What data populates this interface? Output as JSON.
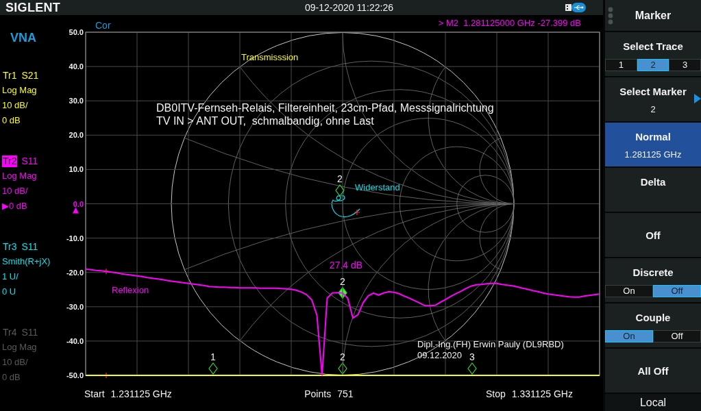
{
  "top_bar": {
    "brand": "SIGLENT",
    "datetime": "09-12-2020 11:22:26"
  },
  "mode": "VNA",
  "traces": [
    {
      "name": "Tr1",
      "param": "S21",
      "format": "Log Mag",
      "scale": "10 dB/",
      "reference": "0 dB",
      "color": "#ffff00",
      "selected": false,
      "on": true
    },
    {
      "name": "Tr2",
      "param": "S11",
      "format": "Log Mag",
      "scale": "10 dB/",
      "reference": "▶0 dB",
      "color": "#ff00ff",
      "selected": true,
      "on": true
    },
    {
      "name": "Tr3",
      "param": "S11",
      "format": "Smith(R+jX)",
      "scale": "1 U/",
      "reference": "0 U",
      "color": "#00e5f0",
      "selected": false,
      "on": true
    },
    {
      "name": "Tr4",
      "param": "S11",
      "format": "Log Mag",
      "scale": "10 dB/",
      "reference": "0 dB",
      "selected": false,
      "on": false
    }
  ],
  "plot": {
    "status": "Cor",
    "marker_readout": "> M2  1.281125000 GHz -27.399 dB",
    "notes": [
      {
        "lines": [
          "DB0ITV-Fernseh-Relais, Filtereinheit, 23cm-Pfad, Messsignalrichtung",
          "TV IN > ANT OUT,  schmalbandig, ohne Last"
        ]
      },
      {
        "lines": [
          "Dipl.-Ing.(FH) Erwin Pauly (DL9RBD)",
          "09.12.2020"
        ]
      }
    ],
    "smith": {
      "label": "Widerstand",
      "color": "#00e5f0",
      "marker": {
        "text": "2",
        "selected": false
      }
    },
    "markers": [
      {
        "text": "2",
        "selected": true
      },
      {
        "text": "1",
        "selected": false
      },
      {
        "text": "2",
        "selected": false
      },
      {
        "text": "3",
        "selected": false
      }
    ],
    "marker_value": "27.4 dB",
    "chart_data": {
      "type": "line",
      "grid": true,
      "ylim": [
        -50,
        50
      ],
      "yticks": [
        {
          "value": 50,
          "label": "50.0"
        },
        {
          "value": 40,
          "label": "40.0"
        },
        {
          "value": 30,
          "label": "30.0"
        },
        {
          "value": 20,
          "label": "20.0"
        },
        {
          "value": 10,
          "label": "10.0"
        },
        {
          "value": 0,
          "label": "0.0"
        },
        {
          "value": -10,
          "label": "-10.0"
        },
        {
          "value": -20,
          "label": "-20.0"
        },
        {
          "value": -30,
          "label": "-30.0"
        },
        {
          "value": -40,
          "label": "-40.0"
        },
        {
          "value": -50,
          "label": "-50.0"
        }
      ],
      "categories": [
        null,
        null,
        null,
        null,
        null,
        null,
        null,
        null,
        null,
        null,
        null,
        null,
        null,
        null,
        null,
        null,
        null,
        null,
        null,
        null,
        null,
        null,
        null,
        null,
        null,
        null,
        null,
        null,
        null,
        null,
        null,
        null,
        null,
        null,
        null,
        null,
        null,
        null,
        null,
        null,
        null,
        null,
        null,
        null,
        null,
        null,
        null,
        null,
        null,
        null,
        null,
        null,
        null,
        null,
        null,
        null,
        null,
        null,
        null,
        null,
        null,
        null,
        null,
        null,
        null,
        null,
        null,
        null,
        null,
        null,
        null,
        null,
        null,
        null,
        null,
        null,
        null,
        null,
        null,
        null,
        null,
        null,
        null,
        null,
        null,
        null,
        null,
        null,
        null,
        null,
        null,
        null,
        null,
        null,
        null,
        null,
        null,
        null,
        null,
        null,
        null
      ],
      "series": [
        {
          "name": "Transmisssion",
          "color": "#ffff00",
          "values": [
            -50,
            -50,
            -50,
            -50,
            -50,
            -50,
            -50,
            -50,
            -50,
            -50,
            -50,
            -50,
            -50,
            -50,
            -50,
            -50,
            -50,
            -50,
            -50,
            -50,
            -50,
            -50,
            -50,
            -50,
            -50,
            -50,
            -50,
            -50,
            -50,
            -50,
            -50,
            -50,
            -50,
            -50,
            -50,
            -50,
            -50,
            -50,
            -50,
            -50,
            -50,
            -50,
            -50,
            -50,
            -50,
            -50,
            -50,
            -50,
            -50,
            -50,
            -50,
            -50,
            -50,
            -50,
            -50,
            -50,
            -50,
            -50,
            -50,
            -50,
            -50,
            -50,
            -50,
            -50,
            -50,
            -50,
            -50,
            -50,
            -50,
            -50,
            -50,
            -50,
            -50,
            -50,
            -50,
            -50,
            -50,
            -50,
            -50,
            -50,
            -50,
            -50,
            -50,
            -50,
            -50,
            -50,
            -50,
            -50,
            -50,
            -50,
            -50,
            -50,
            -50,
            -50,
            -50,
            -50,
            -50,
            -50,
            -50,
            -50,
            -50
          ]
        },
        {
          "name": "Reflexion",
          "color": "#ff00ff",
          "values": [
            -19.0,
            -19.2,
            -19.4,
            -19.5,
            -19.7,
            -19.9,
            -20.1,
            -20.4,
            -20.6,
            -20.8,
            -21.0,
            -21.2,
            -21.5,
            -21.7,
            -21.9,
            -22.1,
            -22.4,
            -22.6,
            -22.8,
            -23.0,
            -23.2,
            -23.4,
            -23.6,
            -23.8,
            -24.1,
            -24.2,
            -24.3,
            -24.3,
            -24.4,
            -24.4,
            -24.5,
            -24.5,
            -24.5,
            -24.5,
            -24.6,
            -24.6,
            -24.6,
            -24.6,
            -24.7,
            -24.8,
            -24.9,
            -25.2,
            -25.7,
            -26.5,
            -28.0,
            -32.5,
            -50.0,
            -27.5,
            -26.0,
            -25.9,
            -26.0,
            -27.5,
            -33.3,
            -32.3,
            -28.8,
            -26.8,
            -26.0,
            -26.6,
            -26.0,
            -25.6,
            -25.8,
            -26.2,
            -26.9,
            -27.5,
            -28.2,
            -28.9,
            -29.7,
            -29.7,
            -29.6,
            -28.7,
            -27.9,
            -27.0,
            -26.2,
            -25.5,
            -24.7,
            -24.0,
            -23.6,
            -23.5,
            -23.3,
            -23.2,
            -23.2,
            -23.5,
            -23.7,
            -23.9,
            -24.2,
            -24.6,
            -24.9,
            -25.3,
            -25.6,
            -26.0,
            -26.3,
            -26.5,
            -26.7,
            -26.9,
            -27.1,
            -27.2,
            -27.2,
            -26.9,
            -26.7,
            -26.5,
            -26.3
          ]
        }
      ]
    }
  },
  "sweep": [
    {
      "label": "Start",
      "value": "1.231125 GHz"
    },
    {
      "label": "Points",
      "value": "751"
    },
    {
      "label": "Stop",
      "value": "1.331125 GHz"
    }
  ],
  "softkeys": {
    "title": "Marker",
    "items": [
      {
        "kind": "segmented",
        "label": "Select Trace",
        "options": [
          {
            "label": "1",
            "selected": false
          },
          {
            "label": "2",
            "selected": true
          },
          {
            "label": "3",
            "selected": false
          }
        ]
      },
      {
        "kind": "field",
        "label": "Select Marker",
        "value": "2",
        "selected": false,
        "submenu": true
      },
      {
        "kind": "field",
        "label": "Normal",
        "value": "1.281125 GHz",
        "selected": true,
        "submenu": false
      },
      {
        "kind": "field",
        "label": "Delta",
        "selected": false,
        "submenu": false
      },
      {
        "kind": "button",
        "label": "Off",
        "selected": false,
        "submenu": false
      },
      {
        "kind": "segmented",
        "label": "Discrete",
        "options": [
          {
            "label": "On",
            "selected": false
          },
          {
            "label": "Off",
            "selected": true
          }
        ]
      },
      {
        "kind": "segmented",
        "label": "Couple",
        "options": [
          {
            "label": "On",
            "selected": true
          },
          {
            "label": "Off",
            "selected": false
          }
        ]
      },
      {
        "kind": "button",
        "label": "All Off",
        "selected": false,
        "submenu": false
      }
    ],
    "status": "Local"
  }
}
